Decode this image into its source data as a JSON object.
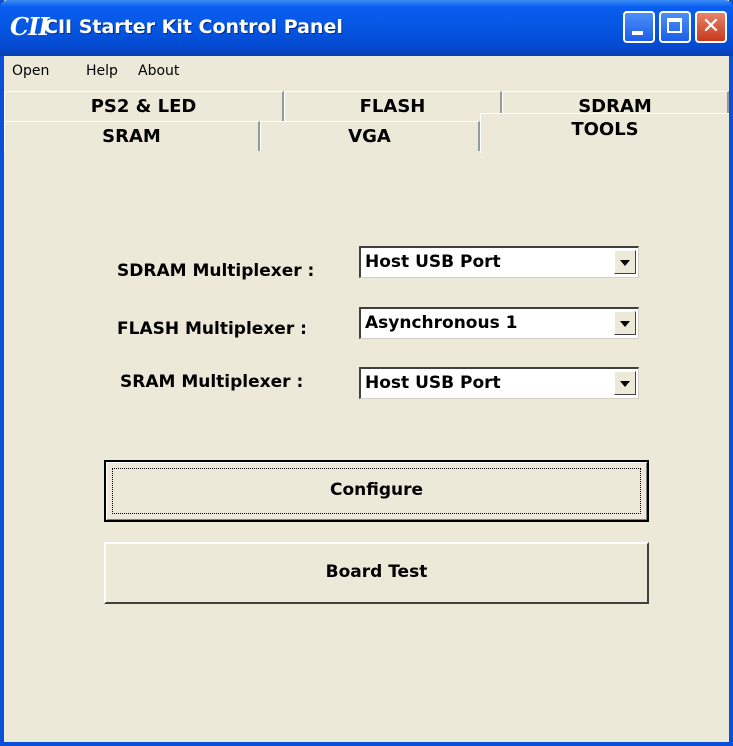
{
  "window": {
    "logo": "CII",
    "title": "CII Starter Kit Control Panel"
  },
  "menu": {
    "items": [
      "Open",
      "Help",
      "About"
    ]
  },
  "tabs": {
    "back_row": [
      "PS2 & LED",
      "FLASH",
      "SDRAM"
    ],
    "front_row": [
      "SRAM",
      "VGA",
      "TOOLS"
    ],
    "active": "TOOLS"
  },
  "tools": {
    "sdram": {
      "label": "SDRAM Multiplexer :",
      "value": "Host USB Port"
    },
    "flash": {
      "label": "FLASH Multiplexer :",
      "value": "Asynchronous 1"
    },
    "sram": {
      "label": "SRAM Multiplexer :",
      "value": "Host USB Port"
    },
    "configure_label": "Configure",
    "board_test_label": "Board Test"
  },
  "icons": {
    "minimize": "minimize-icon",
    "maximize": "maximize-icon",
    "close": "close-icon",
    "dropdown": "chevron-down-icon"
  },
  "colors": {
    "titlebar": "#0556e2",
    "background": "#ece9d8",
    "close_button": "#c7391b"
  }
}
